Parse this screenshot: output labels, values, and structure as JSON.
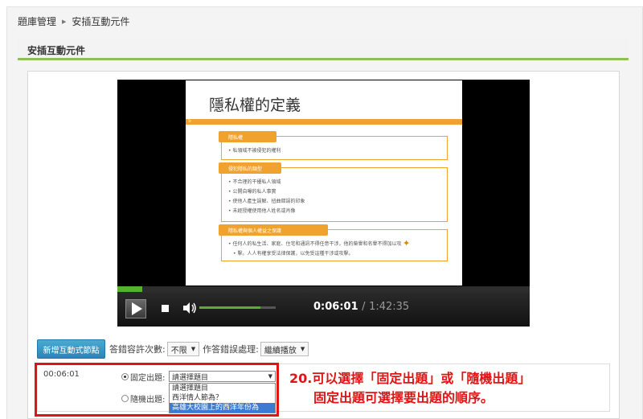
{
  "breadcrumb": {
    "parent": "題庫管理",
    "current": "安插互動元件"
  },
  "section": {
    "title": "安插互動元件"
  },
  "slide": {
    "title": "隱私權的定義",
    "bar_number": "5",
    "boxes": [
      {
        "heading": "隱私權",
        "items": [
          "私領域不被侵犯的權利"
        ]
      },
      {
        "heading": "侵犯隱私的類型",
        "items": [
          "不合理的干擾私人領域",
          "公開自曝的私人事實",
          "使他人產生誤解、扭曲錯誤的印象",
          "未經授權使用他人姓名或肖像"
        ]
      },
      {
        "heading": "隱私權與個人權益之保護",
        "items": [
          "任何人的私生活、家庭、住宅和通訊不得任意干涉，他的榮譽和名譽不得加以攻",
          "擊。人人有權享受法律保護，以免受這種干涉或攻擊。"
        ]
      }
    ]
  },
  "player": {
    "progress": 0.06,
    "volume": 0.8,
    "current_time": "0:06:01",
    "separator": "/",
    "duration": "1:42:35"
  },
  "toolbar": {
    "add_button": "新增互動式節點",
    "attempts_label": "答錯容許次數:",
    "attempts_value": "不限",
    "wrong_label": "作答錯誤處理:",
    "wrong_value": "繼續播放"
  },
  "node": {
    "time": "00:06:01",
    "fixed_label": "固定出題:",
    "random_label": "隨機出題:",
    "select_value": "請選擇題目",
    "options": [
      "請選擇題目",
      "西洋情人節為？",
      "高雄大校園上的西洋年份為"
    ]
  },
  "annotation": {
    "number": "20.",
    "line1": "可以選擇「固定出題」或「隨機出題」",
    "line2": "固定出題可選擇要出題的順序。"
  },
  "colors": {
    "accent_green": "#8dbf58",
    "button_blue": "#3a97c4",
    "highlight_red": "#e01414",
    "slide_orange": "#f0a22e"
  }
}
